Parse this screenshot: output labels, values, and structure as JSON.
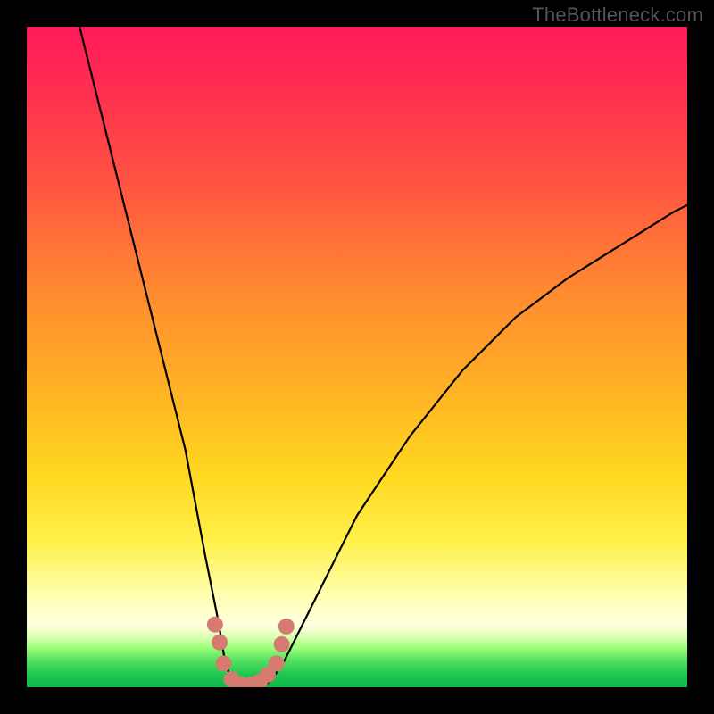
{
  "watermark": "TheBottleneck.com",
  "chart_data": {
    "type": "line",
    "title": "",
    "xlabel": "",
    "ylabel": "",
    "xlim": [
      0,
      100
    ],
    "ylim": [
      0,
      100
    ],
    "grid": false,
    "legend": false,
    "annotations": [],
    "background_gradient": {
      "direction": "vertical",
      "stops": [
        {
          "pos": 0,
          "color": "#ff1a5a"
        },
        {
          "pos": 25,
          "color": "#ff5840"
        },
        {
          "pos": 55,
          "color": "#ffb224"
        },
        {
          "pos": 78,
          "color": "#fff04a"
        },
        {
          "pos": 90,
          "color": "#ffffe0"
        },
        {
          "pos": 96,
          "color": "#52e060"
        },
        {
          "pos": 100,
          "color": "#10b848"
        }
      ]
    },
    "series": [
      {
        "name": "bottleneck-curve",
        "x": [
          8,
          12,
          16,
          20,
          24,
          27,
          29,
          30,
          31,
          32.5,
          34,
          35.5,
          37,
          39,
          43,
          50,
          58,
          66,
          74,
          82,
          90,
          98,
          100
        ],
        "y": [
          100,
          84,
          68,
          52,
          36,
          20,
          10,
          4,
          1,
          0,
          0,
          0,
          1,
          4,
          12,
          26,
          38,
          48,
          56,
          62,
          67,
          72,
          73
        ]
      }
    ],
    "markers": {
      "name": "bottom-dots",
      "color": "#d77a6f",
      "points": [
        {
          "x": 28.5,
          "y": 9.5
        },
        {
          "x": 29.2,
          "y": 6.8
        },
        {
          "x": 29.8,
          "y": 3.6
        },
        {
          "x": 31.0,
          "y": 1.2
        },
        {
          "x": 32.5,
          "y": 0.4
        },
        {
          "x": 34.0,
          "y": 0.4
        },
        {
          "x": 35.3,
          "y": 0.9
        },
        {
          "x": 36.5,
          "y": 1.9
        },
        {
          "x": 37.8,
          "y": 3.6
        },
        {
          "x": 38.6,
          "y": 6.5
        },
        {
          "x": 39.3,
          "y": 9.2
        }
      ]
    }
  }
}
